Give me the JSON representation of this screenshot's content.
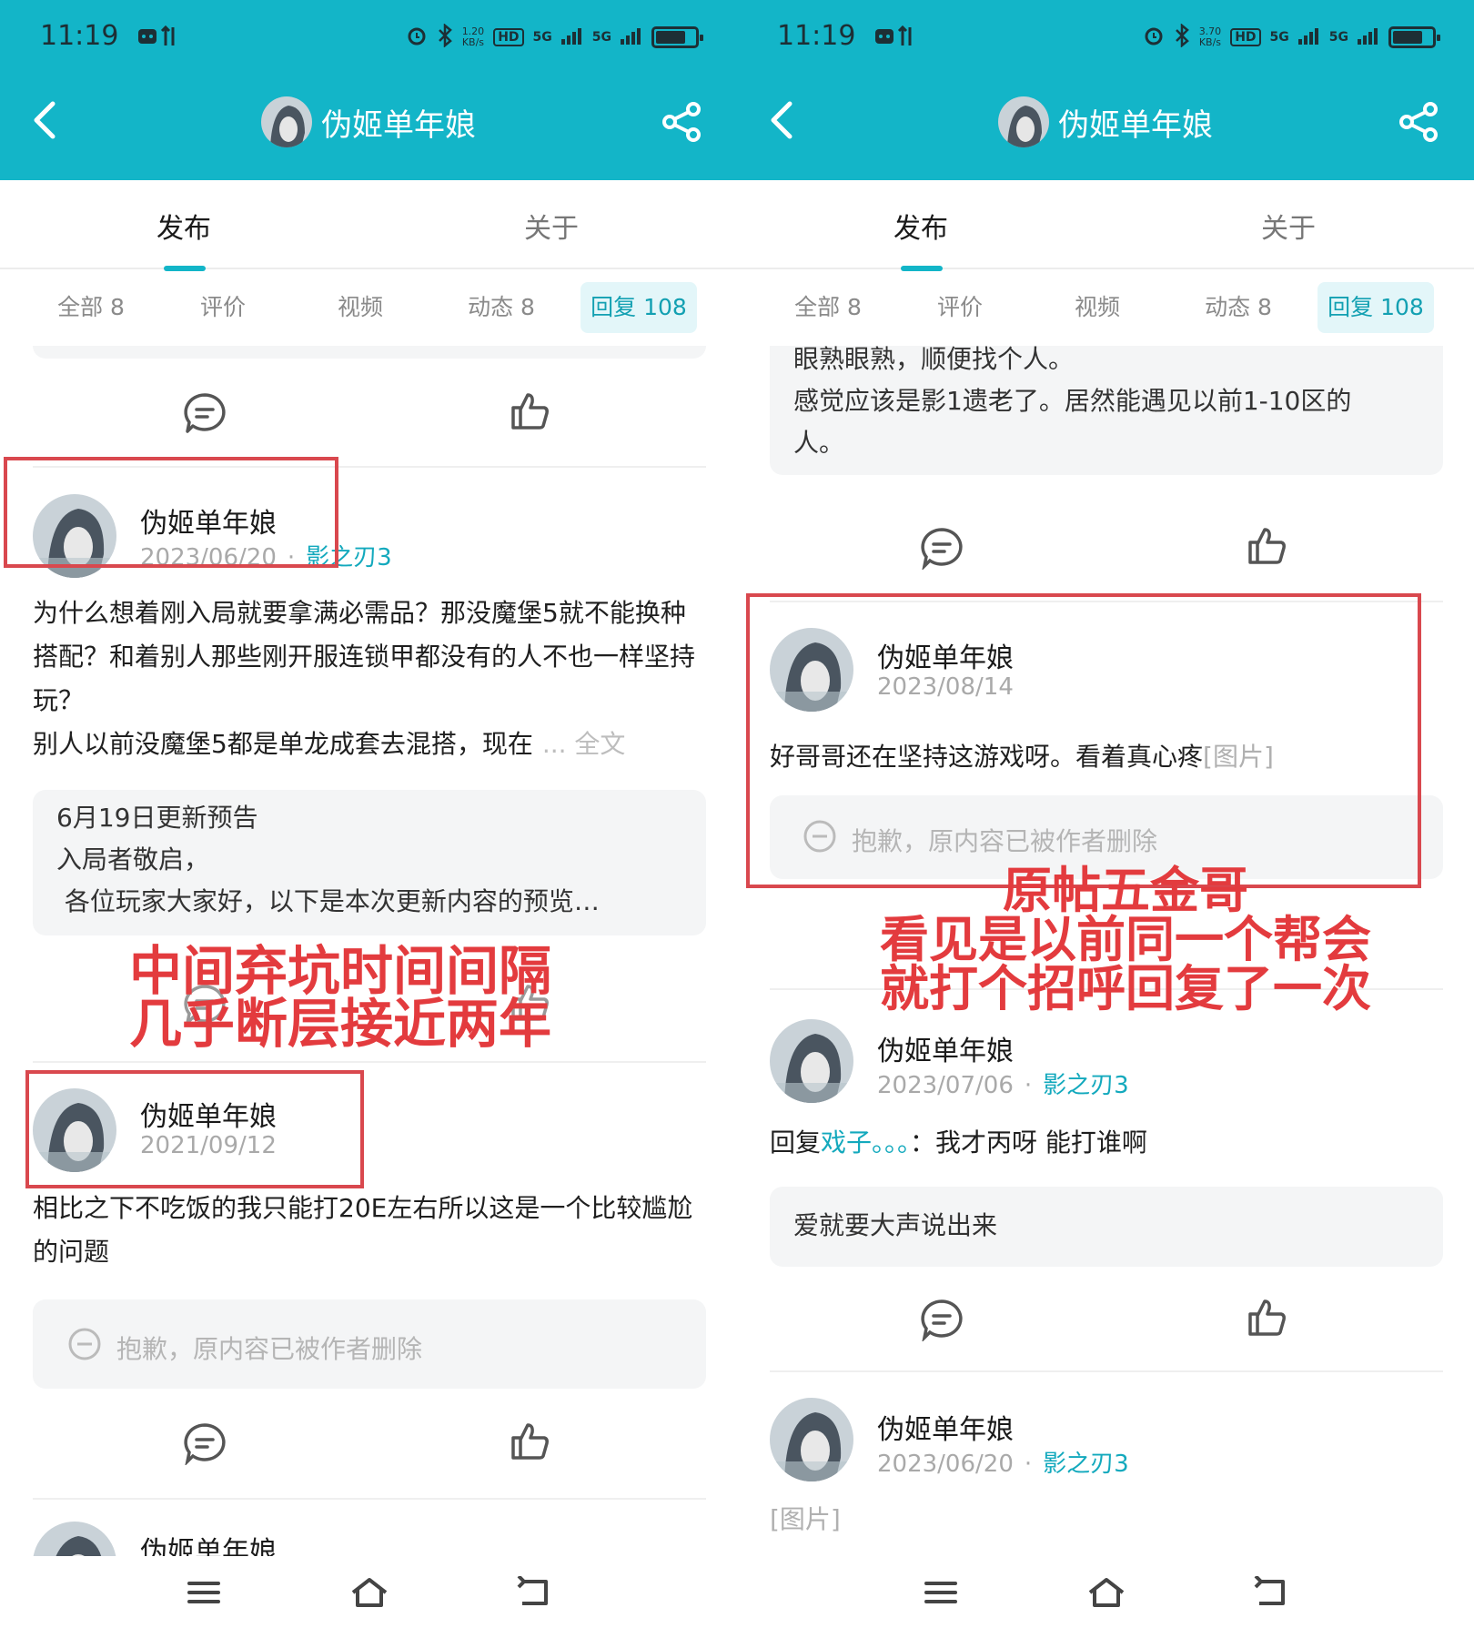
{
  "status_bar": {
    "time": "11:19",
    "left_speed": "1.20",
    "right_speed": "3.70",
    "speed_unit": "KB/s",
    "hd": "HD",
    "net": "5G"
  },
  "header": {
    "title": "伪姬单年娘"
  },
  "tabs": [
    "发布",
    "关于"
  ],
  "filters": [
    "全部 8",
    "评价",
    "视频",
    "动态 8",
    "回复 108"
  ],
  "left": {
    "post1": {
      "author": "伪姬单年娘",
      "date": "2023/06/20",
      "game": "影之刃3",
      "text": "为什么想着刚入局就要拿满必需品？那没魔堡5就不能换种搭配？和着别人那些刚开服连锁甲都没有的人不也一样坚持玩？",
      "text_last": "别人以前没魔堡5都是单龙成套去混搭，现在",
      "more": "... 全文",
      "quote_lines": [
        "6月19日更新预告",
        "入局者敬启，",
        " 各位玩家大家好，以下是本次更新内容的预览…"
      ]
    },
    "post2": {
      "author": "伪姬单年娘",
      "date": "2021/09/12",
      "text": "相比之下不吃饭的我只能打20E左右所以这是一个比较尴尬的问题",
      "deleted": "抱歉，原内容已被作者删除"
    },
    "post3": {
      "author": "伪姬单年娘"
    },
    "annotation": [
      "中间弃坑时间间隔",
      "几乎断层接近两年"
    ]
  },
  "right": {
    "top_quote_lines": [
      "眼熟眼熟，顺便找个人。",
      "感觉应该是影1遗老了。居然能遇见以前1-10区的",
      "人。"
    ],
    "post1": {
      "author": "伪姬单年娘",
      "date": "2023/08/14",
      "text": "好哥哥还在坚持这游戏呀。看着真心疼",
      "image_tag": "[图片]",
      "deleted": "抱歉，原内容已被作者删除"
    },
    "post2": {
      "author": "伪姬单年娘",
      "date": "2023/07/06",
      "game": "影之刃3",
      "reply_prefix": "回复",
      "reply_to": "戏子。。。",
      "reply_text": "：我才丙呀 能打谁啊",
      "quote": "爱就要大声说出来"
    },
    "post3": {
      "author": "伪姬单年娘",
      "date": "2023/06/20",
      "game": "影之刃3",
      "image_tag": "[图片]"
    },
    "annotation": [
      "原帖五金哥",
      "看见是以前同一个帮会",
      "就打个招呼回复了一次"
    ]
  },
  "colors": {
    "accent": "#13b5c8",
    "annotation_red": "#e33b3e",
    "box_red": "#d9484e"
  },
  "icons": [
    "back-icon",
    "share-icon",
    "comment-icon",
    "like-icon",
    "menu-icon",
    "home-icon",
    "return-icon"
  ]
}
